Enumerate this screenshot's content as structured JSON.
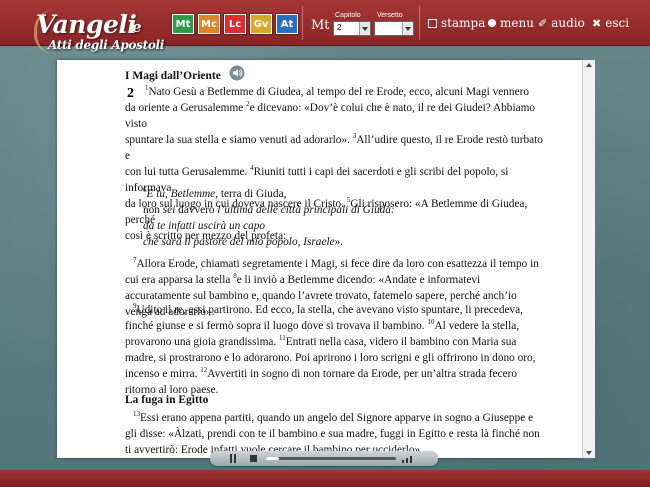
{
  "app": {
    "title_main": "Vangeli",
    "title_conj": "e",
    "title_sub": "Atti degli Apostoli"
  },
  "gospels": [
    {
      "label": "Mt",
      "color": "#2e9b4a"
    },
    {
      "label": "Mc",
      "color": "#e0842a"
    },
    {
      "label": "Lc",
      "color": "#d83030"
    },
    {
      "label": "Gv",
      "color": "#d8a82a"
    },
    {
      "label": "At",
      "color": "#2a6fc4"
    }
  ],
  "nav": {
    "book": "Mt",
    "chapter_label": "Capitolo",
    "chapter_value": "2",
    "verse_label": "Versetto",
    "verse_value": ""
  },
  "menu": {
    "print": "stampa",
    "menu": "menu",
    "audio": "audio",
    "exit": "esci"
  },
  "document": {
    "section1_title": "I Magi dall’Oriente",
    "chapter": "2",
    "para1": [
      {
        "v": "1",
        "t": "Nato Gesù a Betlemme di Giudea, al tempo del re Erode, ecco, alcuni Magi vennero"
      },
      {
        "v": "",
        "t": "da oriente a Gerusalemme "
      },
      {
        "v": "2",
        "t": "e dicevano: «Dov’è colui che è nato, il re dei Giudei? Abbiamo visto"
      },
      {
        "v": "",
        "t": "spuntare la sua stella e siamo venuti ad adorarlo». "
      },
      {
        "v": "3",
        "t": "All’udire questo, il re Erode restò turbato e"
      },
      {
        "v": "",
        "t": "con lui tutta Gerusalemme. "
      },
      {
        "v": "4",
        "t": "Riuniti tutti i capi dei sacerdoti e gli scribi del popolo, si informava"
      },
      {
        "v": "",
        "t": "da loro sul luogo in cui doveva nascere il Cristo. "
      },
      {
        "v": "5",
        "t": "Gli risposero: «A Betlemme di Giudea, perché"
      },
      {
        "v": "",
        "t": "così è scritto per mezzo del profeta:"
      }
    ],
    "poem_v": "6",
    "poem": [
      "E tu, Betlemme, terra di Giuda,",
      "non sei davvero l’ultima delle città principali di Giuda:",
      "da te infatti uscirà un capo",
      "che sarà il pastore del mio popolo, Israele»."
    ],
    "poem_plain": {
      "l1_italic": "E tu, Betlemme,",
      "l1_plain": " terra di Giuda,",
      "l2_plain": "non ",
      "l2_italic_a": "sei",
      "l2_plain_b": " davvero ",
      "l2_italic_b": "l’ultima delle città principali di Giuda:",
      "l3": "da te infatti uscirà un capo",
      "l4_italic": "che sarà il pastore del mio popolo, Israele",
      "l4_plain": "»."
    },
    "para2_v7": "7",
    "para2_t7": "Allora Erode, chiamati segretamente i Magi, si fece dire da loro con esattezza il tempo in cui era apparsa la stella",
    "para2_v8": "8",
    "para2_t8": "e li inviò a Betlemme dicendo: «Andate e informatevi accuratamente sul bambino e, quando l’avrete trovato, fatemelo sapere, perché anch’io venga ad adorarlo».",
    "para3_v9": "9",
    "para3_t9": "Udito il re, essi partirono. Ed ecco, la stella, che avevano visto spuntare, li precedeva, finché giunse e si fermò sopra il luogo dove si trovava il bambino.",
    "para3_v10": "10",
    "para3_t10": "Al vedere la stella, provarono una gioia grandissima.",
    "para3_v11": "11",
    "para3_t11": "Entrati nella casa, videro il bambino con Maria sua madre, si prostrarono e lo adorarono. Poi aprirono i loro scrigni e gli offrirono in dono oro, incenso e mirra.",
    "para3_v12": "12",
    "para3_t12": "Avvertiti in sogno di non tornare da Erode, per un’altra strada fecero ritorno al loro paese.",
    "section2_title": "La fuga in Egitto",
    "para4_v13": "13",
    "para4_t13": "Essi erano appena partiti, quando un angelo del Signore apparve in sogno a Giuseppe e gli disse: «Àlzati, prendi con te il bambino e sua madre, fuggi in Egitto e resta là finché non ti avvertirò: Erode infatti vuole cercare il bambino per ucciderlo»."
  },
  "player": {
    "progress": 0.1
  }
}
